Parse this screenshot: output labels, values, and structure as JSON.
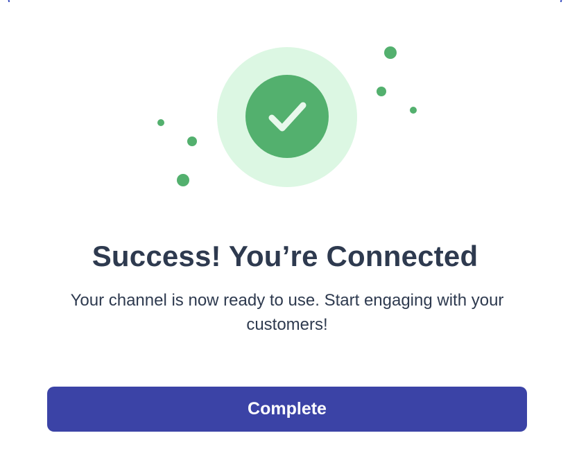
{
  "modal": {
    "title": "Success! You’re Connected",
    "subtitle": "Your channel is now ready to use. Start engaging with your customers!",
    "button_label": "Complete"
  },
  "colors": {
    "accent_green": "#53b06e",
    "halo_green": "#dcf7e3",
    "button_blue": "#3b43a6",
    "text_dark": "#2e3a4f"
  },
  "icons": {
    "success": "check-icon"
  }
}
